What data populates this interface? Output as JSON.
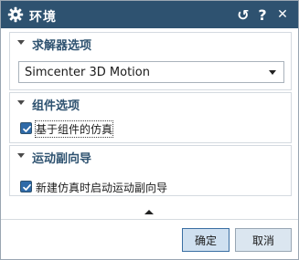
{
  "window": {
    "title": "环境",
    "reset_glyph": "↺",
    "help_glyph": "?",
    "close_glyph": "✕"
  },
  "groups": [
    {
      "title": "求解器选项",
      "select": {
        "value": "Simcenter 3D Motion"
      }
    },
    {
      "title": "组件选项",
      "checkbox": {
        "label": "基于组件的仿真",
        "checked": true
      }
    },
    {
      "title": "运动副向导",
      "checkbox": {
        "label": "新建仿真时启动运动副向导",
        "checked": true
      }
    }
  ],
  "buttons": {
    "ok": "确定",
    "cancel": "取消"
  },
  "colors": {
    "titlebar": "#2e5270",
    "group_title": "#2e5270",
    "checkbox_fill": "#2e6aa8"
  }
}
